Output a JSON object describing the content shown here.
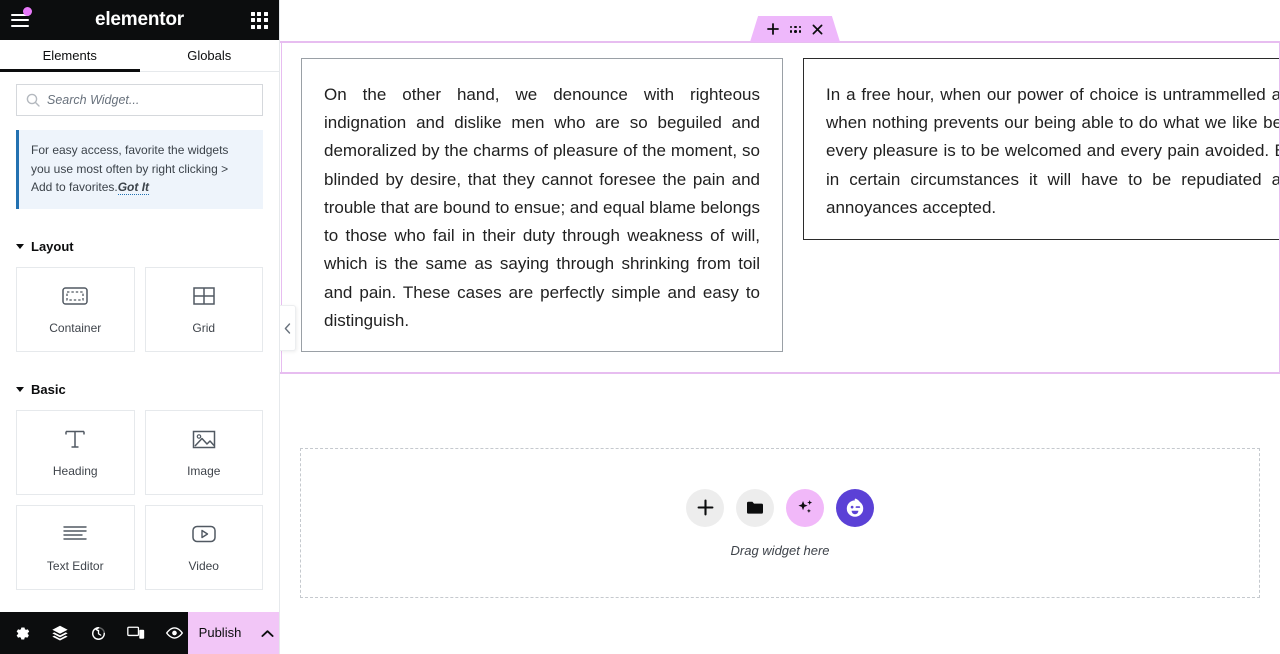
{
  "app": {
    "brand": "elementor",
    "menu_icon": "hamburger-icon",
    "apps_icon": "apps-grid-icon"
  },
  "panel": {
    "tabs": [
      {
        "label": "Elements",
        "active": true
      },
      {
        "label": "Globals",
        "active": false
      }
    ],
    "search": {
      "placeholder": "Search Widget...",
      "value": "",
      "icon": "search-icon"
    },
    "notice": {
      "text": "For easy access, favorite the widgets you use most often by right clicking > Add to favorites.",
      "link_label": "Got It",
      "accent_color": "#2271b1",
      "background": "#eef4fb"
    },
    "categories": [
      {
        "title": "Layout",
        "widgets": [
          {
            "label": "Container",
            "icon": "container-icon"
          },
          {
            "label": "Grid",
            "icon": "grid-icon"
          }
        ]
      },
      {
        "title": "Basic",
        "widgets": [
          {
            "label": "Heading",
            "icon": "heading-icon"
          },
          {
            "label": "Image",
            "icon": "image-icon"
          },
          {
            "label": "Text Editor",
            "icon": "text-editor-icon"
          },
          {
            "label": "Video",
            "icon": "video-icon"
          }
        ]
      }
    ],
    "footer": {
      "tools": [
        {
          "name": "settings",
          "icon": "gear-icon"
        },
        {
          "name": "navigator",
          "icon": "layers-icon"
        },
        {
          "name": "history",
          "icon": "history-icon"
        },
        {
          "name": "responsive-mode",
          "icon": "responsive-devices-icon"
        },
        {
          "name": "preview",
          "icon": "eye-icon"
        }
      ],
      "publish_label": "Publish",
      "publish_color": "#f2c6f7",
      "publish_caret_icon": "chevron-up-icon"
    }
  },
  "canvas": {
    "element_toolbar": {
      "add_icon": "plus-icon",
      "drag_icon": "drag-handle-icon",
      "close_icon": "close-icon",
      "color": "#eeb8fb"
    },
    "section_outline_color": "#e7bdf0",
    "collapse_handle_icon": "chevron-left-icon",
    "text_widgets": [
      {
        "name": "text-widget-left",
        "text": "On the other hand, we denounce with righteous indignation and dislike men who are so beguiled and demoralized by the charms of pleasure of the moment, so blinded by desire, that they cannot foresee the pain and trouble that are bound to ensue; and equal blame belongs to those who fail in their duty through weakness of will, which is the same as saying through shrinking from toil and pain. These cases are perfectly simple and easy to distinguish."
      },
      {
        "name": "text-widget-right",
        "text": "In a free hour, when our power of choice is untrammelled and when nothing prevents our being able to do what we like best, every pleasure is to be welcomed and every pain avoided. But in certain circumstances it will have to be repudiated and annoyances accepted."
      }
    ],
    "drop_zone": {
      "label": "Drag widget here",
      "buttons": [
        {
          "name": "add-element",
          "icon": "plus-icon",
          "color": "#ededed"
        },
        {
          "name": "template-library",
          "icon": "folder-icon",
          "color": "#ededed"
        },
        {
          "name": "ai-generate",
          "icon": "sparkles-icon",
          "color": "#f1b8f9"
        },
        {
          "name": "assistant",
          "icon": "smiley-wink-icon",
          "color": "#5b41d6"
        }
      ]
    }
  }
}
